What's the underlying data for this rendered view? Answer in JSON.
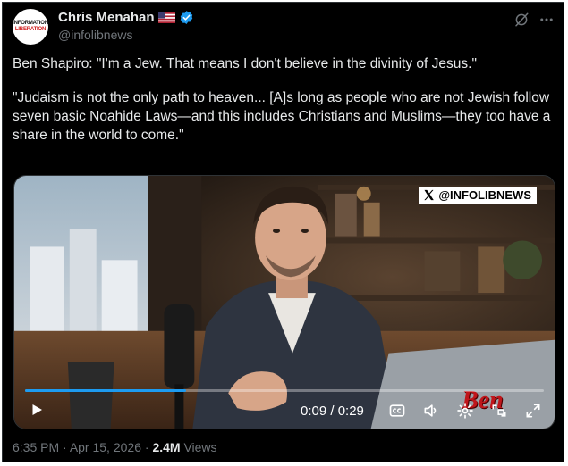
{
  "author": {
    "display_name": "Chris Menahan",
    "handle": "@infolibnews",
    "avatar_line1": "INFORMATION",
    "avatar_line2": "LIBERATION"
  },
  "icons": {
    "flag": "us-flag-icon",
    "verified": "verified-badge-icon",
    "grok": "grok-icon",
    "more": "more-dots-icon",
    "play": "play-icon",
    "captions": "captions-icon",
    "volume": "volume-icon",
    "settings": "gear-icon",
    "pip": "picture-in-picture-icon",
    "fullscreen": "fullscreen-icon"
  },
  "tweet": {
    "paragraph1": "Ben Shapiro: \"I'm a Jew. That means I don't believe in the divinity of Jesus.\"",
    "paragraph2": "\"Judaism is not the only path to heaven... [A]s long as people who are not Jewish follow seven basic Noahide Laws—and this includes Christians and Muslims—they too have a share in the world to come.\""
  },
  "video": {
    "watermark": "@INFOLIBNEWS",
    "time": "0:09 / 0:29",
    "progress": 0.31,
    "brand_logo": "Ben"
  },
  "footer": {
    "time": "6:35 PM",
    "date": "Apr 15, 2026",
    "separator1": " · ",
    "separator2": " · ",
    "views_count": "2.4M",
    "views_label": " Views"
  },
  "colors": {
    "background": "#000000",
    "text": "#e7e9ea",
    "muted": "#71767b",
    "accent": "#1d9bf0"
  }
}
